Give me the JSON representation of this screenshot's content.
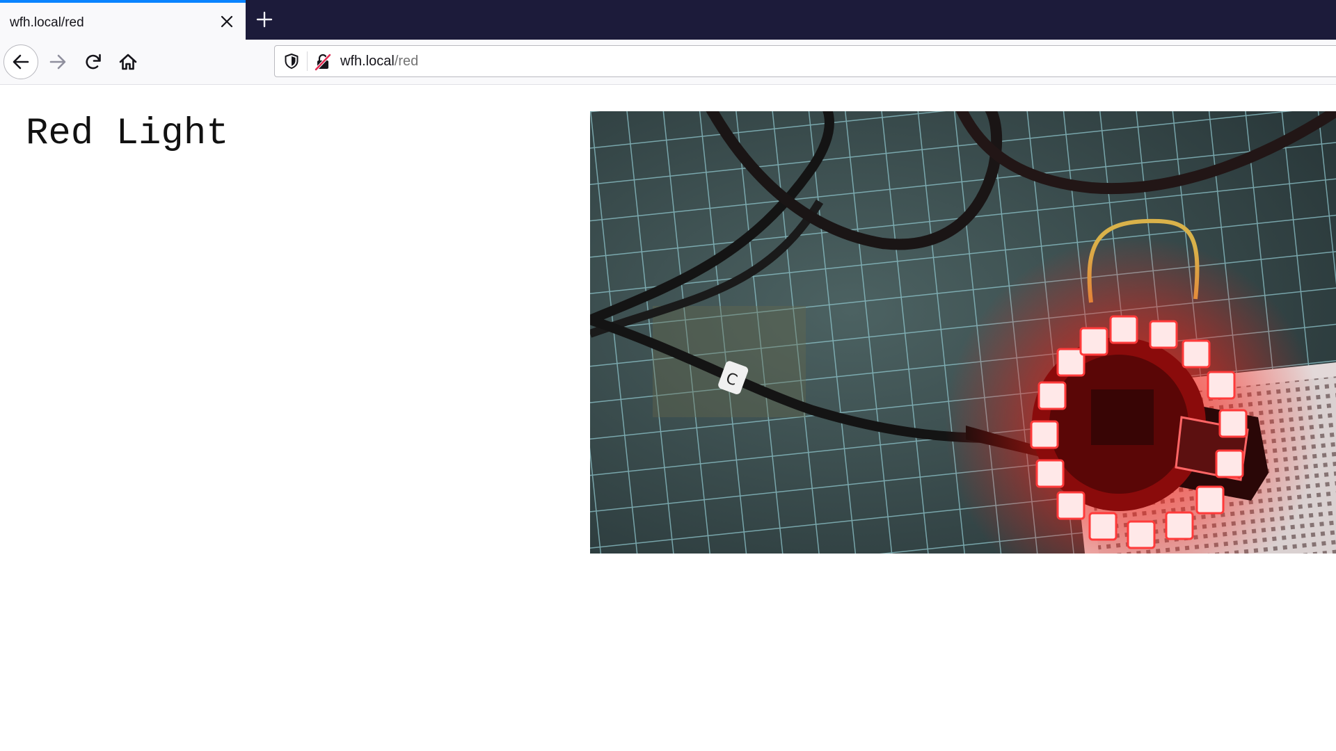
{
  "browser": {
    "tab": {
      "title": "wfh.local/red"
    },
    "address_bar": {
      "host": "wfh.local",
      "path": "/red"
    }
  },
  "page": {
    "title": "Red Light"
  },
  "icons": {
    "tab_close": "close-icon",
    "new_tab": "plus-icon",
    "back": "arrow-left-icon",
    "forward": "arrow-right-icon",
    "reload": "reload-icon",
    "home": "home-icon",
    "tracking": "shield-icon",
    "insecure": "insecure-lock-icon"
  },
  "colors": {
    "tab_active_accent": "#0a84ff",
    "tab_strip_bg": "#1c1b3a",
    "led_red": "#ff1a1a"
  }
}
